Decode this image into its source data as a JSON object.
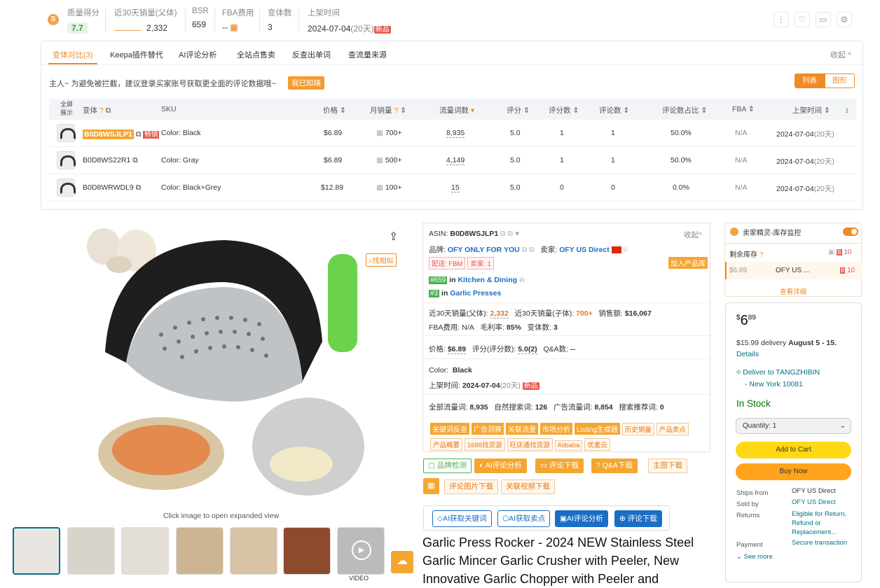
{
  "stats": {
    "quality": {
      "label": "质量得分",
      "value": "7.7"
    },
    "sales30": {
      "label": "近30天销量(父体)",
      "value": "2,332"
    },
    "bsr": {
      "label": "BSR",
      "value": "659"
    },
    "fba": {
      "label": "FBA费用",
      "value": "--"
    },
    "variants": {
      "label": "变体数",
      "value": "3"
    },
    "listed": {
      "label": "上架时间",
      "value": "2024-07-04",
      "days": "(20天)",
      "tag": "新品"
    }
  },
  "tabs": [
    "变体对比(3)",
    "Keepa插件替代",
    "AI评论分析",
    "全站点售卖",
    "反查出单词",
    "查流量来源"
  ],
  "collapse": "收起",
  "notice": "主人~ 为避免被拦截，建议登录买家账号获取更全面的评论数据哦~",
  "notice_btn": "我已知晓",
  "view_toggle": [
    "列表",
    "图形"
  ],
  "table": {
    "headers": [
      "全屏展示",
      "变体",
      "SKU",
      "价格",
      "月销量",
      "流量词数",
      "评分",
      "评分数",
      "评论数",
      "评论数占比",
      "FBA",
      "上架时间"
    ],
    "rows": [
      {
        "asin": "B0D8WSJLP1",
        "hot": "畅销",
        "sku": "Color: Black",
        "price": "$6.89",
        "sales": "700+",
        "words": "8,935",
        "rating": "5.0",
        "rcount": "1",
        "reviews": "1",
        "share": "50.0%",
        "fba": "N/A",
        "date": "2024-07-04",
        "days": "(20天)"
      },
      {
        "asin": "B0D8WS22R1",
        "hot": "",
        "sku": "Color: Gray",
        "price": "$6.89",
        "sales": "500+",
        "words": "4,149",
        "rating": "5.0",
        "rcount": "1",
        "reviews": "1",
        "share": "50.0%",
        "fba": "N/A",
        "date": "2024-07-04",
        "days": "(20天)"
      },
      {
        "asin": "B0D8WRWDL9",
        "hot": "",
        "sku": "Color: Black+Grey",
        "price": "$12.89",
        "sales": "100+",
        "words": "15",
        "rating": "5.0",
        "rcount": "0",
        "reviews": "0",
        "share": "0.0%",
        "fba": "N/A",
        "date": "2024-07-04",
        "days": "(20天)"
      }
    ]
  },
  "image": {
    "caption": "Click image to open expanded view",
    "similar": "找相似",
    "video": "VIDEO"
  },
  "info": {
    "asin_label": "ASIN:",
    "asin": "B0D8WSJLP1",
    "collapse": "收起",
    "brand_label": "品牌:",
    "brand": "OFY ONLY FOR YOU",
    "seller_label": "卖家:",
    "seller": "OFY US Direct",
    "ship": "配送: FBM",
    "sellers": "卖家: 1",
    "add": "加入产品库",
    "rank1": "#659",
    "rank1_in": "in",
    "rank1_cat": "Kitchen & Dining",
    "rank2": "#3",
    "rank2_in": "in",
    "rank2_cat": "Garlic Presses",
    "sales_parent_label": "近30天销量(父体):",
    "sales_parent": "2,332",
    "sales_child_label": "近30天销量(子体):",
    "sales_child": "700+",
    "revenue_label": "销售额:",
    "revenue": "$16,067",
    "fba_label": "FBA费用:",
    "fba": "N/A",
    "margin_label": "毛利率:",
    "margin": "85%",
    "variants_label": "变体数:",
    "variants": "3",
    "price_label": "价格:",
    "price": "$6.89",
    "rating_label": "评分(评分数):",
    "rating": "5.0(2)",
    "qa_label": "Q&A数:",
    "qa": "--",
    "color_label": "Color:",
    "color": "Black",
    "listed_label": "上架时间:",
    "listed": "2024-07-04",
    "days": "(20天)",
    "new": "新品",
    "traffic_label": "全部流量词:",
    "traffic": "8,935",
    "organic_label": "自然搜索词:",
    "organic": "126",
    "ad_label": "广告流量词:",
    "ad": "8,854",
    "rec_label": "搜索推荐词:",
    "rec": "0",
    "tags1": [
      "关键词反查",
      "广告洞察",
      "关联流量",
      "市场分析",
      "Listing生成器",
      "历史销量",
      "产品卖点"
    ],
    "tags2": [
      "产品概要",
      "1688找货源",
      "旺店通找货源",
      "Alibaba",
      "优麦云"
    ]
  },
  "buttons1": [
    "品牌检测",
    "AI评论分析",
    "评论下载",
    "Q&A下载",
    "主图下载"
  ],
  "buttons1b": [
    "评论图片下载",
    "关联视频下载"
  ],
  "buttons2": [
    "AI获取关键词",
    "AI获取卖点",
    "AI评论分析",
    "评论下载"
  ],
  "title": "Garlic Press Rocker - 2024 NEW Stainless Steel Garlic Mincer Garlic Crusher with Peeler, New Innovative Garlic Chopper with Peeler and",
  "sprite": {
    "title": "卖家精灵-库存监控",
    "stock_label": "剩余库存",
    "stock_count": "10",
    "price": "$6.89",
    "seller": "OFY US ...",
    "seller_count": "10",
    "more": "查看详细"
  },
  "buybox": {
    "price_symbol": "$",
    "price_whole": "6",
    "price_frac": "89",
    "delivery": "$15.99 delivery",
    "delivery_date": "August 5 - 15.",
    "details": "Details",
    "deliver_to": "Deliver to TANGZHIBIN",
    "city": "- New York 10081",
    "stock": "In Stock",
    "qty": "Quantity: 1",
    "add_cart": "Add to Cart",
    "buy_now": "Buy Now",
    "ships_label": "Ships from",
    "ships": "OFY US Direct",
    "sold_label": "Sold by",
    "sold": "OFY US Direct",
    "returns_label": "Returns",
    "returns": "Eligible for Return, Refund or Replacement...",
    "payment_label": "Payment",
    "payment": "Secure transaction",
    "see_more": "See more"
  },
  "colors": {
    "accent": "#f08a24",
    "blue": "#1a6ec5",
    "green": "#4caf50",
    "amazon_yellow": "#ffd814",
    "amazon_orange": "#ffa41c"
  }
}
